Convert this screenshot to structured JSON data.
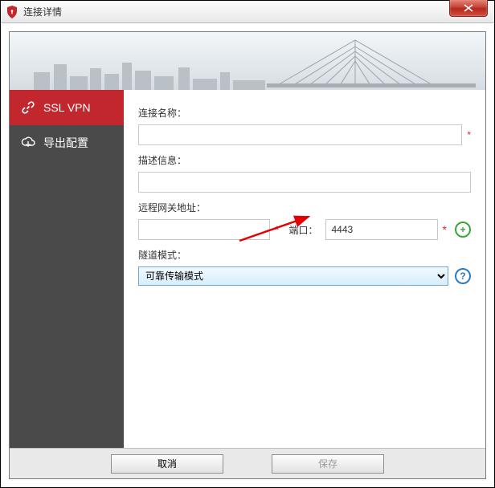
{
  "window": {
    "title": "连接详情"
  },
  "sidebar": {
    "items": [
      {
        "label": "SSL VPN",
        "icon": "link-icon",
        "active": true
      },
      {
        "label": "导出配置",
        "icon": "cloud-download-icon",
        "active": false
      }
    ]
  },
  "form": {
    "connection_name_label": "连接名称：",
    "connection_name_value": "",
    "description_label": "描述信息：",
    "description_value": "",
    "gateway_label": "远程网关地址：",
    "gateway_value": "",
    "port_label": "端口：",
    "port_value": "4443",
    "tunnel_label": "隧道模式：",
    "tunnel_selected": "可靠传输模式",
    "tunnel_options": [
      "可靠传输模式"
    ]
  },
  "buttons": {
    "cancel": "取消",
    "save": "保存",
    "add": "+",
    "help": "?"
  },
  "colors": {
    "accent_red": "#c1272d",
    "required": "#d22",
    "help_blue": "#2a7bbf",
    "add_green": "#3aa53a"
  }
}
